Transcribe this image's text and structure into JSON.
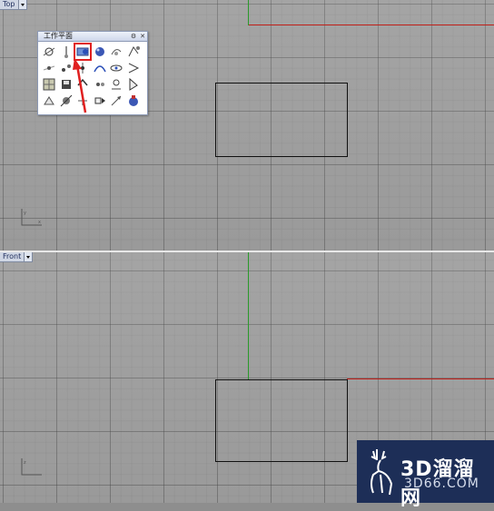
{
  "viewports": {
    "top": {
      "label": "Top"
    },
    "front": {
      "label": "Front"
    }
  },
  "toolbar": {
    "title": "工作平面",
    "tools": [
      "cplane-origin-icon",
      "cplane-elevation-icon",
      "cplane-object-icon",
      "cplane-sphere-icon",
      "cplane-rotate-icon",
      "cplane-3point-icon",
      "cplane-x-axis-icon",
      "cplane-z-axis-icon",
      "cplane-vertical-icon",
      "cplane-curve-icon",
      "cplane-view-icon",
      "cplane-perpendicular-icon",
      "cplane-top-icon",
      "cplane-save-icon",
      "cplane-previous-icon",
      "cplane-next-icon",
      "cplane-named-icon",
      "cplane-cursor-icon",
      "cplane-surface-icon",
      "cplane-set-icon",
      "cplane-world-icon",
      "cplane-shift-icon",
      "cplane-arrow-icon",
      "cplane-ball-icon"
    ],
    "selected_index": 2
  },
  "watermark": {
    "name": "3D溜溜网",
    "url": "3D66.COM"
  },
  "colors": {
    "x_axis": "#c0201a",
    "y_axis": "#2a9a2a",
    "highlight": "#e02020",
    "logo_bg": "#1d2e57"
  }
}
